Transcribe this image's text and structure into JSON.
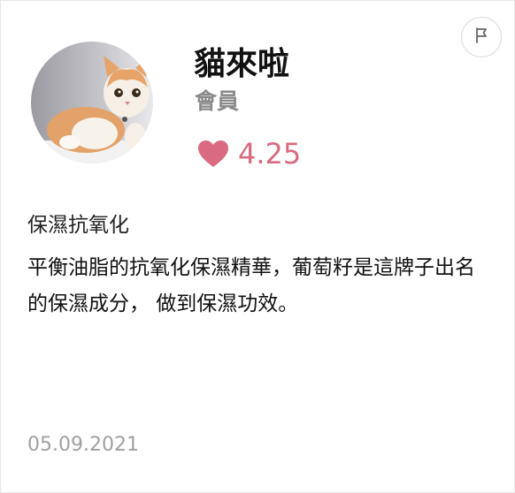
{
  "reviewer": {
    "name": "貓來啦",
    "role": "會員",
    "avatar_desc": "cat-avatar"
  },
  "rating": {
    "value": "4.25",
    "icon": "heart-icon",
    "color": "#d96a80"
  },
  "report": {
    "icon": "flag-icon"
  },
  "review": {
    "title": "保濕抗氧化",
    "body": "平衡油脂的抗氧化保濕精華，葡萄籽是這牌子出名的保濕成分， 做到保濕功效。",
    "date": "05.09.2021"
  }
}
